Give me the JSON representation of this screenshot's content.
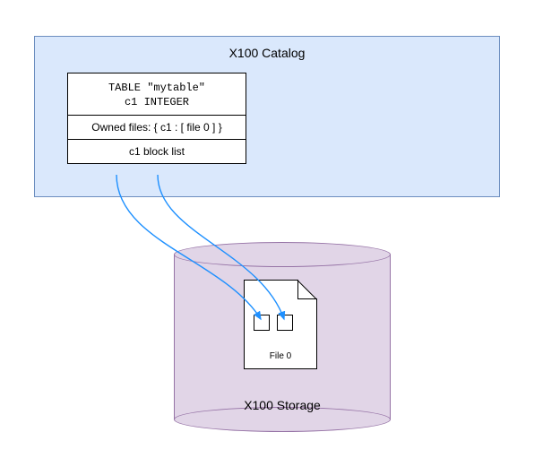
{
  "catalog": {
    "title": "X100 Catalog",
    "table": {
      "heading_line1": "TABLE \"mytable\"",
      "heading_line2": "c1 INTEGER",
      "owned_files": "Owned files: { c1 : [ file 0 ] }",
      "block_list": "c1 block list"
    }
  },
  "storage": {
    "label": "X100 Storage",
    "file": {
      "label": "File 0"
    }
  }
}
